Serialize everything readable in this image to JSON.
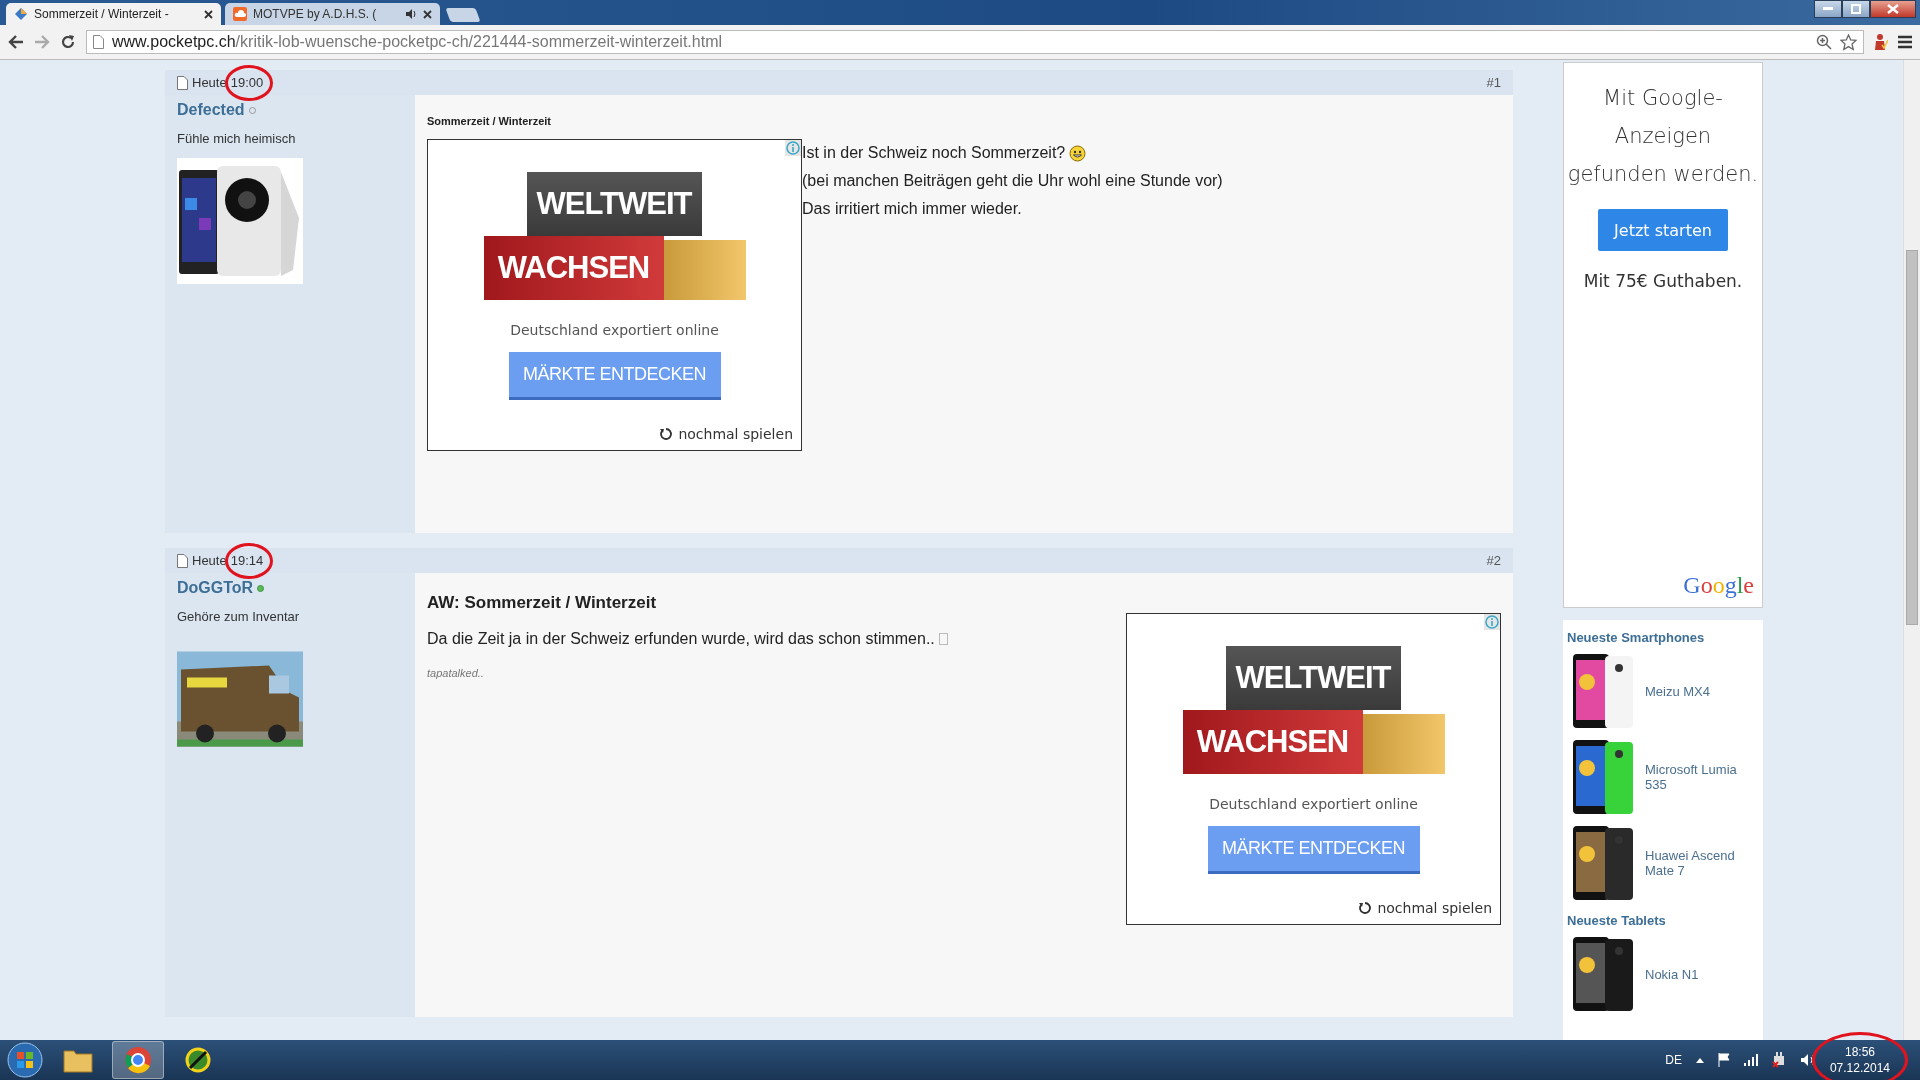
{
  "browser": {
    "tabs": [
      {
        "title": "Sommerzeit / Winterzeit -",
        "selected": true,
        "audio": false
      },
      {
        "title": "MOTVPE by A.D.H.S. (",
        "selected": false,
        "audio": true
      }
    ],
    "address": {
      "host": "www.pocketpc.ch",
      "path": "/kritik-lob-wuensche-pocketpc-ch/221444-sommerzeit-winterzeit.html"
    }
  },
  "posts": [
    {
      "kind": "first",
      "day": "Heute",
      "time": "19:00",
      "number": "#1",
      "author": "Defected",
      "online": false,
      "rank": "Fühle mich heimisch",
      "title": "Sommerzeit / Winterzeit",
      "lines": [
        {
          "text": "Ist in der Schweiz noch Sommerzeit?",
          "kind": "smiley"
        },
        {
          "text": "(bei manchen Beiträgen geht die Uhr wohl eine Stunde vor)",
          "kind": "plain"
        },
        {
          "text": "Das irritiert mich immer wieder.",
          "kind": "plain"
        }
      ],
      "ad": {
        "headline_top": "WELTWEIT",
        "headline_bottom": "WACHSEN",
        "tagline": "Deutschland exportiert online",
        "button": "MÄRKTE ENTDECKEN",
        "replay": "nochmal spielen"
      }
    },
    {
      "kind": "reply",
      "day": "Heute",
      "time": "19:14",
      "number": "#2",
      "author": "DoGGToR",
      "online": true,
      "rank": "Gehöre zum Inventar",
      "title": "AW: Sommerzeit / Winterzeit",
      "lines": [
        {
          "text": "Da die Zeit ja in der Schweiz erfunden wurde, wird das schon stimmen..",
          "kind": "glyph"
        }
      ],
      "signature": "tapatalked..",
      "ad": {
        "headline_top": "WELTWEIT",
        "headline_bottom": "WACHSEN",
        "tagline": "Deutschland exportiert online",
        "button": "MÄRKTE ENTDECKEN",
        "replay": "nochmal spielen"
      }
    }
  ],
  "sidebar": {
    "google_ad": {
      "text": "Mit Google-Anzeigen gefunden werden.",
      "button": "Jetzt starten",
      "note": "Mit 75€ Guthaben.",
      "logo": "Google"
    },
    "sections": [
      {
        "title": "Neueste Smartphones",
        "items": [
          {
            "name": "Meizu MX4"
          },
          {
            "name": "Microsoft Lumia 535"
          },
          {
            "name": "Huawei Ascend Mate 7"
          }
        ]
      },
      {
        "title": "Neueste Tablets",
        "items": [
          {
            "name": "Nokia N1"
          }
        ]
      }
    ]
  },
  "taskbar": {
    "language": "DE",
    "time": "18:56",
    "date": "07.12.2014"
  }
}
